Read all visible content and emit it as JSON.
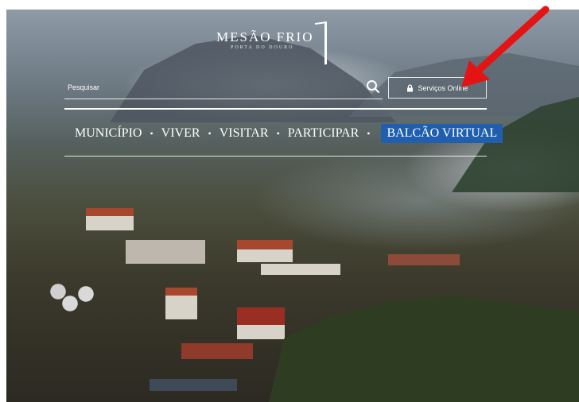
{
  "site": {
    "title": "MESÃO FRIO",
    "subtitle": "PORTA DO DOURO"
  },
  "search": {
    "placeholder": "Pesquisar",
    "icon": "search-icon"
  },
  "services": {
    "label": "Serviços Online",
    "icon": "lock-icon"
  },
  "nav": {
    "separator": "•",
    "items": [
      {
        "label": "MUNICÍPIO"
      },
      {
        "label": "VIVER"
      },
      {
        "label": "VISITAR"
      },
      {
        "label": "PARTICIPAR"
      },
      {
        "label": "BALCÃO VIRTUAL"
      }
    ]
  },
  "colors": {
    "accent": "#1f5fae",
    "annotation_arrow": "#e41414",
    "text": "#ffffff"
  }
}
